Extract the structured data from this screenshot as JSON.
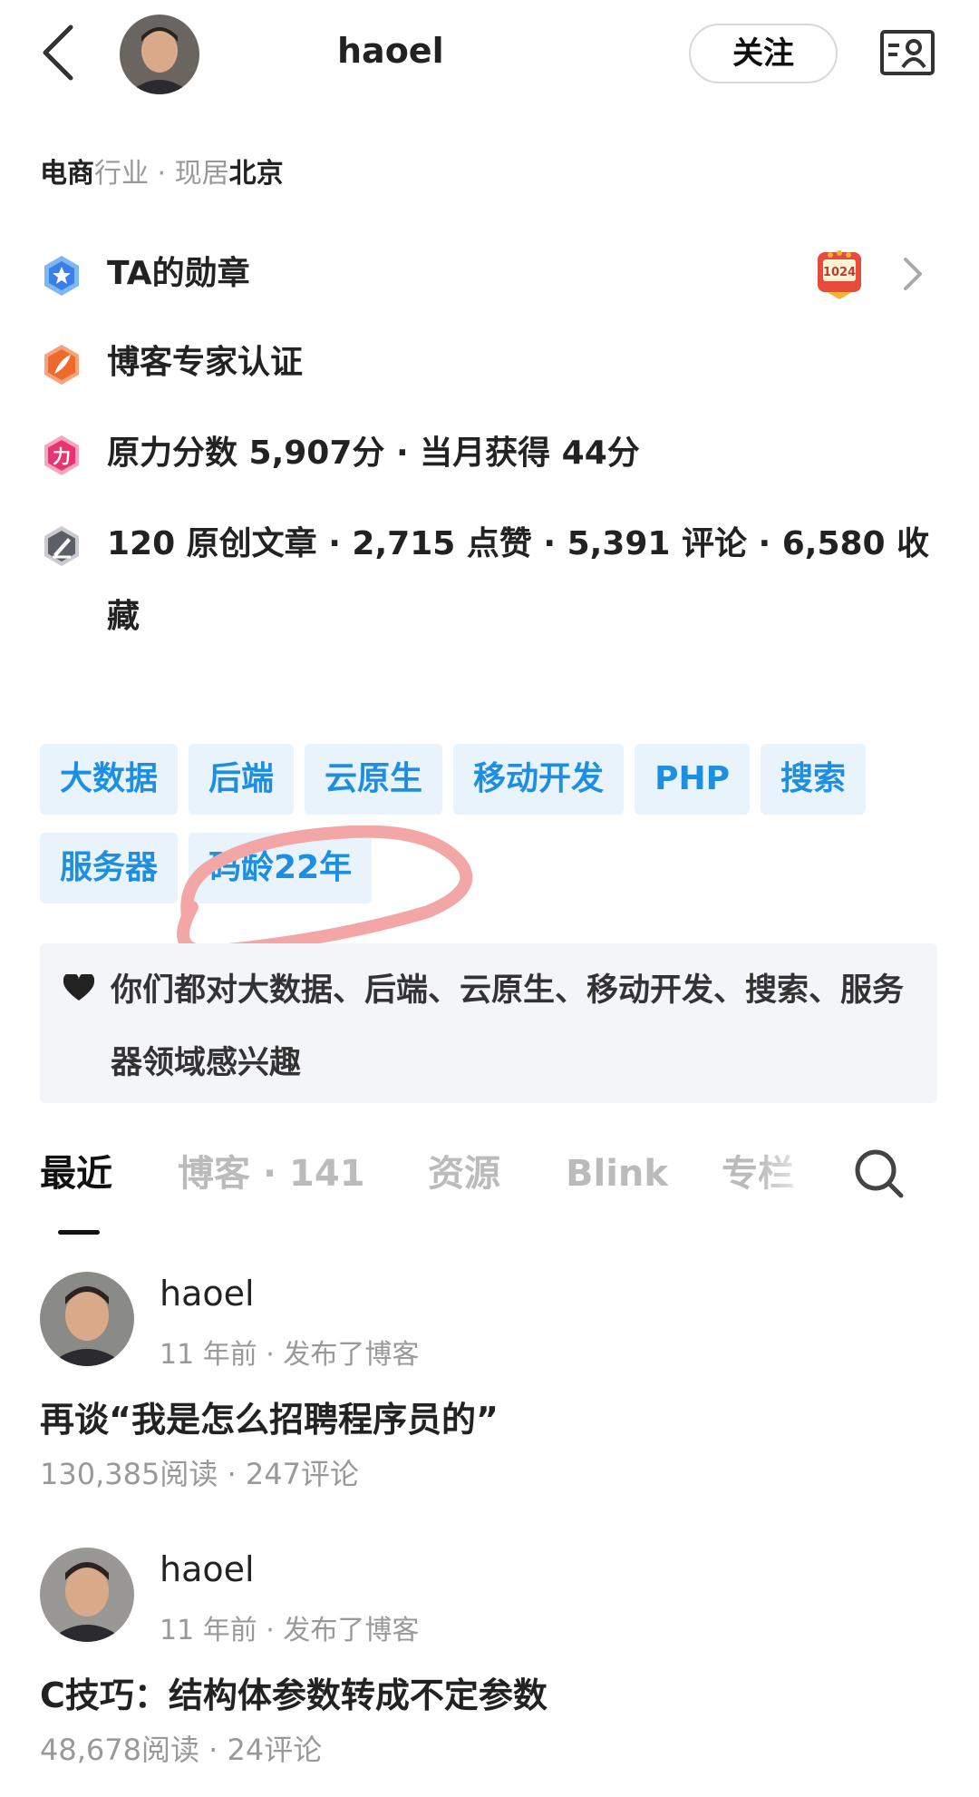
{
  "header": {
    "username": "haoel",
    "follow_label": "关注"
  },
  "profile": {
    "industry": "电商",
    "industry_suffix": "行业 · 现居",
    "city": "北京"
  },
  "info_rows": {
    "medals": "TA的勋章",
    "medal_badge": "1024",
    "expert": "博客专家认证",
    "power": "原力分数 5,907分 · 当月获得 44分",
    "stats": "120 原创文章 · 2,715 点赞 · 5,391 评论 · 6,580 收藏"
  },
  "tags": [
    "大数据",
    "后端",
    "云原生",
    "移动开发",
    "PHP",
    "搜索",
    "服务器",
    "码龄22年"
  ],
  "interest": {
    "text": "你们都对大数据、后端、云原生、移动开发、搜索、服务器领域感兴趣"
  },
  "tabs": {
    "recent": "最近",
    "blog": "博客 · 141",
    "resources": "资源",
    "blink": "Blink",
    "column": "专栏"
  },
  "posts": [
    {
      "author": "haoel",
      "meta": "11 年前 · 发布了博客",
      "title": "再谈“我是怎么招聘程序员的”",
      "stats": "130,385阅读 · 247评论"
    },
    {
      "author": "haoel",
      "meta": "11 年前 · 发布了博客",
      "title": "C技巧：结构体参数转成不定参数",
      "stats": "48,678阅读 · 24评论"
    }
  ],
  "colors": {
    "accent_blue": "#1e8ee0",
    "tag_bg": "#e8f3fc",
    "annotation_red": "#f3a6a6"
  },
  "icons": {
    "back": "chevron-left-icon",
    "card": "profile-card-icon",
    "medal": "shield-star-icon",
    "expert": "expert-feather-icon",
    "power": "power-score-icon",
    "stats": "articles-icon",
    "search": "search-icon",
    "heart": "heart-icon"
  }
}
